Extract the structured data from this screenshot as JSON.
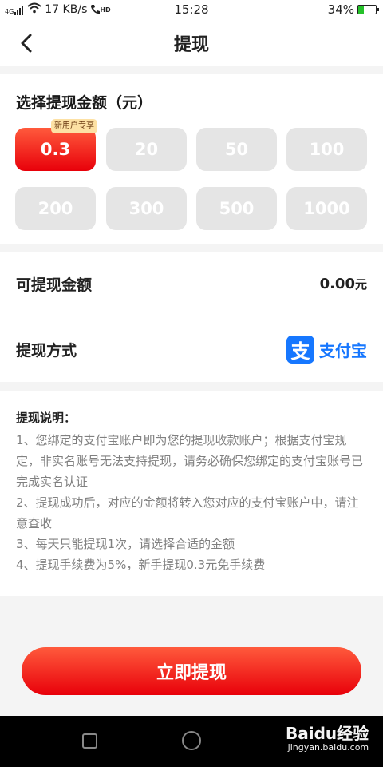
{
  "status_bar": {
    "net_label": "4G",
    "speed": "17 KB/s",
    "hd_label": "HD",
    "time": "15:28",
    "battery": "34%",
    "battery_fraction": 0.34
  },
  "nav": {
    "title": "提现"
  },
  "amount_section": {
    "title": "选择提现金额（元）",
    "badge": "新用户专享",
    "options": [
      "0.3",
      "20",
      "50",
      "100",
      "200",
      "300",
      "500",
      "1000"
    ],
    "selected": "0.3"
  },
  "info": {
    "balance_label": "可提现金额",
    "balance_value": "0.00",
    "balance_unit": "元",
    "method_label": "提现方式",
    "method_name": "支付宝",
    "method_logo_char": "支"
  },
  "notes": {
    "title": "提现说明：",
    "items": [
      "1、您绑定的支付宝账户即为您的提现收款账户；根据支付宝规定，非实名账号无法支持提现，请务必确保您绑定的支付宝账号已完成实名认证",
      "2、提现成功后，对应的金额将转入您对应的支付宝账户中，请注意查收",
      "3、每天只能提现1次，请选择合适的金额",
      "4、提现手续费为5%，新手提现0.3元免手续费"
    ]
  },
  "submit_label": "立即提现",
  "watermark": {
    "main": "Baidu经验",
    "url": "jingyan.baidu.com"
  },
  "colors": {
    "accent_red": "#e8000a",
    "alipay_blue": "#1677ff",
    "disabled_gray": "#e5e5e5"
  }
}
